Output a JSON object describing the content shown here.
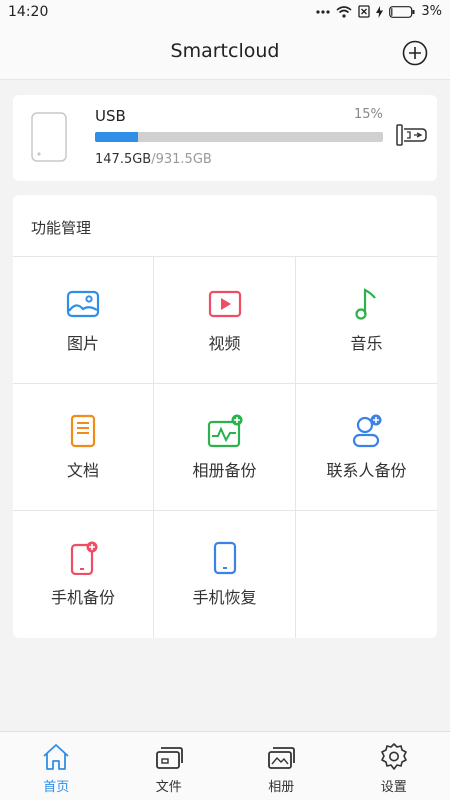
{
  "status": {
    "time": "14:20",
    "battery": "3%"
  },
  "header": {
    "title": "Smartcloud",
    "add_icon": "plus-circle-icon"
  },
  "device": {
    "name": "USB",
    "percent_label": "15%",
    "used": "147.5GB",
    "total": "/931.5GB",
    "usage_fraction": 0.15
  },
  "functions": {
    "title": "功能管理",
    "items": [
      {
        "label": "图片",
        "icon": "image-icon",
        "color": "#2f8fe6"
      },
      {
        "label": "视频",
        "icon": "video-icon",
        "color": "#ee4d64"
      },
      {
        "label": "音乐",
        "icon": "music-icon",
        "color": "#2bb24c"
      },
      {
        "label": "文档",
        "icon": "document-icon",
        "color": "#f08c1a"
      },
      {
        "label": "相册备份",
        "icon": "album-backup-icon",
        "color": "#2bb24c"
      },
      {
        "label": "联系人备份",
        "icon": "contact-backup-icon",
        "color": "#3b82e6"
      },
      {
        "label": "手机备份",
        "icon": "phone-backup-icon",
        "color": "#ee4d64"
      },
      {
        "label": "手机恢复",
        "icon": "phone-restore-icon",
        "color": "#3b82e6"
      }
    ]
  },
  "tabs": [
    {
      "label": "首页",
      "icon": "home-icon",
      "active": true
    },
    {
      "label": "文件",
      "icon": "files-icon",
      "active": false
    },
    {
      "label": "相册",
      "icon": "album-icon",
      "active": false
    },
    {
      "label": "设置",
      "icon": "settings-icon",
      "active": false
    }
  ],
  "colors": {
    "accent": "#2f8fe6",
    "background": "#f3f3f3",
    "card": "#ffffff"
  }
}
